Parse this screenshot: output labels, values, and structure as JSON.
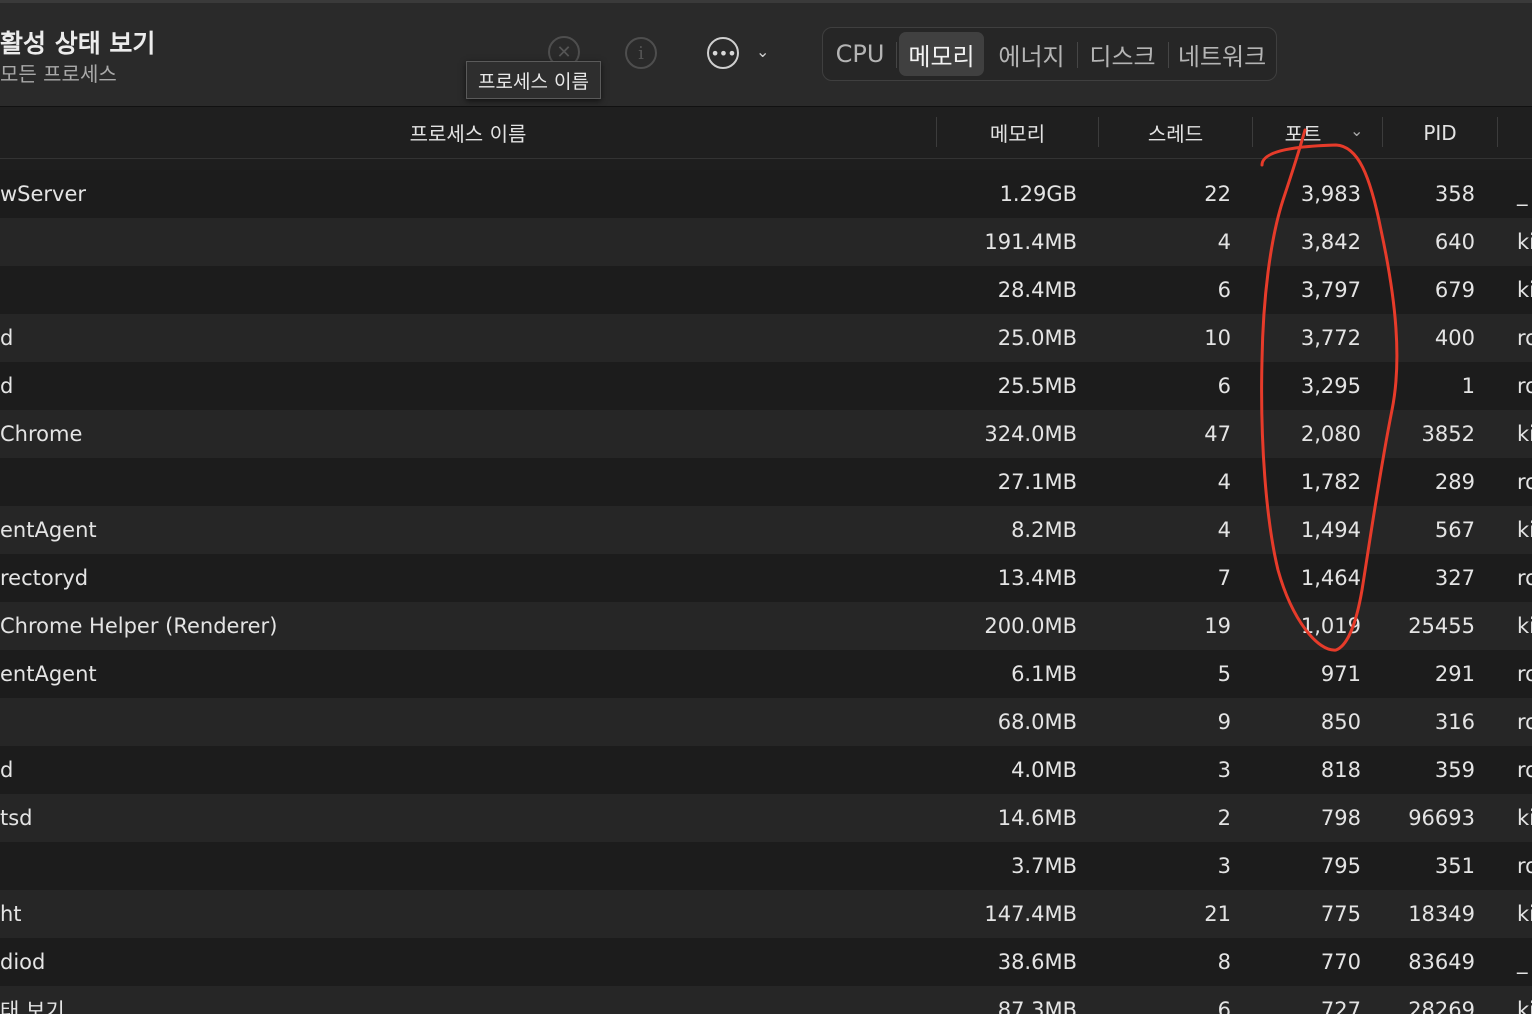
{
  "window": {
    "title": "활성 상태 보기",
    "subtitle": "모든 프로세스"
  },
  "toolbar": {
    "stop_glyph": "✕",
    "info_glyph": "i",
    "more_glyph": "•••",
    "chevron_glyph": "⌄",
    "tooltip": "프로세스 이름",
    "tabs": [
      "CPU",
      "메모리",
      "에너지",
      "디스크",
      "네트워크"
    ],
    "active_tab": "메모리"
  },
  "table": {
    "columns": {
      "name": "프로세스 이름",
      "memory": "메모리",
      "threads": "스레드",
      "ports": "포트",
      "pid": "PID"
    },
    "sort_glyph": "⌄",
    "rows": [
      {
        "name": "wServer",
        "memory": "1.29GB",
        "threads": "22",
        "ports": "3,983",
        "pid": "358",
        "user": "_"
      },
      {
        "name": "",
        "memory": "191.4MB",
        "threads": "4",
        "ports": "3,842",
        "pid": "640",
        "user": "ki"
      },
      {
        "name": "",
        "memory": "28.4MB",
        "threads": "6",
        "ports": "3,797",
        "pid": "679",
        "user": "ki"
      },
      {
        "name": "d",
        "memory": "25.0MB",
        "threads": "10",
        "ports": "3,772",
        "pid": "400",
        "user": "ro"
      },
      {
        "name": "d",
        "memory": "25.5MB",
        "threads": "6",
        "ports": "3,295",
        "pid": "1",
        "user": "ro"
      },
      {
        "name": " Chrome",
        "memory": "324.0MB",
        "threads": "47",
        "ports": "2,080",
        "pid": "3852",
        "user": "ki"
      },
      {
        "name": "",
        "memory": "27.1MB",
        "threads": "4",
        "ports": "1,782",
        "pid": "289",
        "user": "ro"
      },
      {
        "name": "entAgent",
        "memory": "8.2MB",
        "threads": "4",
        "ports": "1,494",
        "pid": "567",
        "user": "ki"
      },
      {
        "name": "rectoryd",
        "memory": "13.4MB",
        "threads": "7",
        "ports": "1,464",
        "pid": "327",
        "user": "ro"
      },
      {
        "name": " Chrome Helper (Renderer)",
        "memory": "200.0MB",
        "threads": "19",
        "ports": "1,019",
        "pid": "25455",
        "user": "ki"
      },
      {
        "name": "entAgent",
        "memory": "6.1MB",
        "threads": "5",
        "ports": "971",
        "pid": "291",
        "user": "ro"
      },
      {
        "name": "",
        "memory": "68.0MB",
        "threads": "9",
        "ports": "850",
        "pid": "316",
        "user": "ro"
      },
      {
        "name": "d",
        "memory": "4.0MB",
        "threads": "3",
        "ports": "818",
        "pid": "359",
        "user": "ro"
      },
      {
        "name": "tsd",
        "memory": "14.6MB",
        "threads": "2",
        "ports": "798",
        "pid": "96693",
        "user": "ki"
      },
      {
        "name": "",
        "memory": "3.7MB",
        "threads": "3",
        "ports": "795",
        "pid": "351",
        "user": "ro"
      },
      {
        "name": "ht",
        "memory": "147.4MB",
        "threads": "21",
        "ports": "775",
        "pid": "18349",
        "user": "ki"
      },
      {
        "name": "diod",
        "memory": "38.6MB",
        "threads": "8",
        "ports": "770",
        "pid": "83649",
        "user": "_"
      },
      {
        "name": "태 보기",
        "memory": "87.3MB",
        "threads": "6",
        "ports": "727",
        "pid": "28269",
        "user": "ki"
      }
    ]
  },
  "colors": {
    "annotation_stroke": "#e63b2a",
    "active_tab_bg": "#404040",
    "row_even": "#262626",
    "row_odd": "#1c1c1c"
  }
}
